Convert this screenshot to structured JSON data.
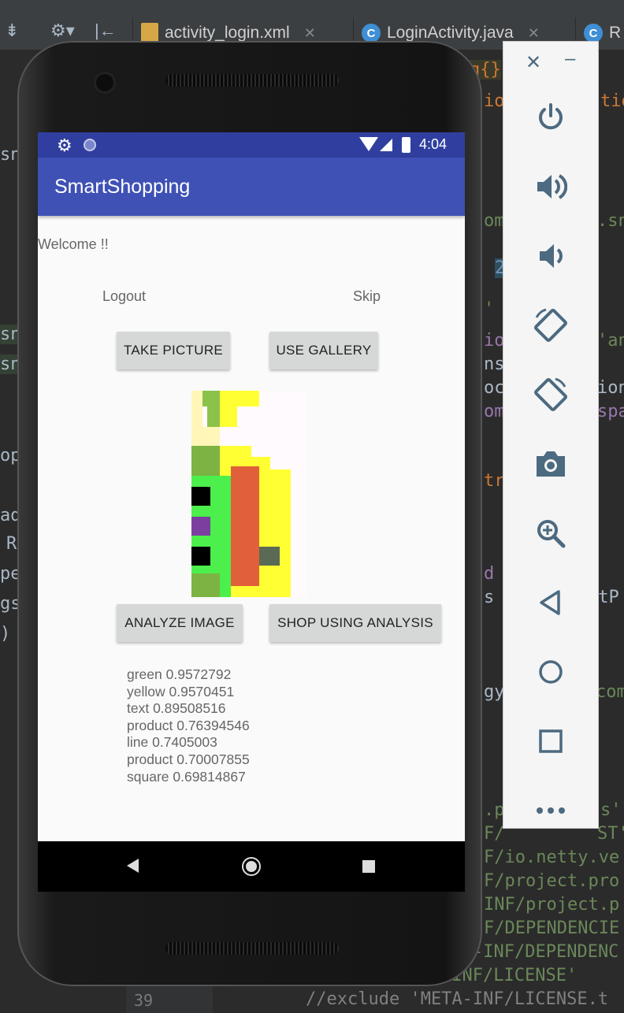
{
  "ide": {
    "tabs": [
      {
        "label": "activity_login.xml",
        "icon": "xml-file-icon"
      },
      {
        "label": "LoginActivity.java",
        "icon": "java-class-icon"
      },
      {
        "label": "R",
        "icon": "java-class-icon"
      }
    ],
    "code_fragments": {
      "l1": "g{}",
      "l2": "io",
      "l3": "tio",
      "l4": "sn",
      "l5": "om",
      "l6": ".sn",
      "l7": "2",
      "l8": "'",
      "l9": "io",
      "l10": "'an",
      "l11": "sn",
      "l12": "ns",
      "l13": "sn",
      "l14": "oc",
      "l15": "ion",
      "l16": "om",
      "l17": "spa",
      "l18": "op",
      "l19": "tr",
      "l20": "ad",
      "l21": "R",
      "l22": "d",
      "l23": "pe",
      "l24": "s",
      "l25": "ltP",
      "l26": "gs",
      "l27": ")",
      "l28": "gy",
      "l29": "com",
      "l30": ".p",
      "l31": "s'",
      "l32": "F/",
      "l33": "ST'",
      "l34": "F/io.netty.ve",
      "l35": "F/project.pro",
      "l36": "INF/project.p",
      "l37": "F/DEPENDENCIE",
      "l38": "-INF/DEPENDENC",
      "l39": "-INF/LICENSE'",
      "l40": "//exclude 'META-INF/LICENSE.t"
    },
    "line_number": "39"
  },
  "status_bar": {
    "time": "4:04"
  },
  "app": {
    "title": "SmartShopping",
    "welcome": "Welcome !!",
    "logout_label": "Logout",
    "skip_label": "Skip",
    "take_picture_label": "TAKE PICTURE",
    "use_gallery_label": "USE GALLERY",
    "analyze_label": "ANALYZE IMAGE",
    "shop_label": "SHOP USING ANALYSIS",
    "results": [
      "green 0.9572792",
      "yellow 0.9570451",
      "text 0.89508516",
      "product 0.76394546",
      "line 0.7405003",
      "product 0.70007855",
      "square 0.69814867"
    ]
  },
  "emulator_controls": [
    "power-icon",
    "volume-up-icon",
    "volume-down-icon",
    "rotate-left-icon",
    "rotate-right-icon",
    "camera-icon",
    "zoom-icon",
    "back-icon",
    "home-icon",
    "overview-icon",
    "more-icon"
  ],
  "colors": {
    "primary": "#3f51b5",
    "primary_dark": "#303f9f",
    "button_bg": "#d6d7d7",
    "emu_icon": "#4c6a80"
  }
}
